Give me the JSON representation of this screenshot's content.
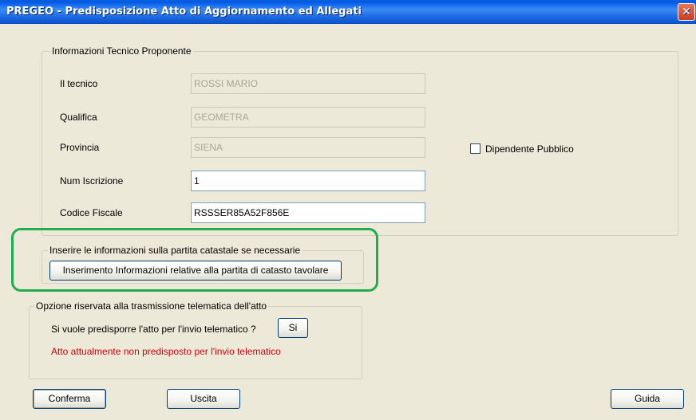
{
  "window": {
    "title": "PREGEO - Predisposizione Atto di Aggiornamento ed Allegati",
    "close_glyph": "✕"
  },
  "tecnico_group": {
    "legend": "Informazioni Tecnico Proponente",
    "fields": {
      "tecnico": {
        "label": "Il tecnico",
        "value": "ROSSI MARIO"
      },
      "qualifica": {
        "label": "Qualifica",
        "value": "GEOMETRA"
      },
      "provincia": {
        "label": "Provincia",
        "value": "SIENA"
      },
      "num_iscrizione": {
        "label": "Num Iscrizione",
        "value": "1"
      },
      "codice_fiscale": {
        "label": "Codice Fiscale",
        "value": "RSSSER85A52F856E"
      }
    },
    "dipendente_pubblico": {
      "label": "Dipendente Pubblico",
      "checked": false
    }
  },
  "partita_group": {
    "legend": "Inserire le informazioni sulla partita catastale se necessarie",
    "button_label": "Inserimento Informazioni relative alla partita di catasto tavolare"
  },
  "telematica_group": {
    "legend": "Opzione riservata alla trasmissione telematica dell'atto",
    "question": "Si vuole predisporre l'atto per l'invio telematico ?",
    "si_button": "Si",
    "status": "Atto attualmente non predisposto per l'invio telematico"
  },
  "footer": {
    "conferma": "Conferma",
    "uscita": "Uscita",
    "guida": "Guida"
  },
  "colors": {
    "highlight": "#1fae4e",
    "status_text": "#d4000b",
    "titlebar": "#0058e6"
  }
}
